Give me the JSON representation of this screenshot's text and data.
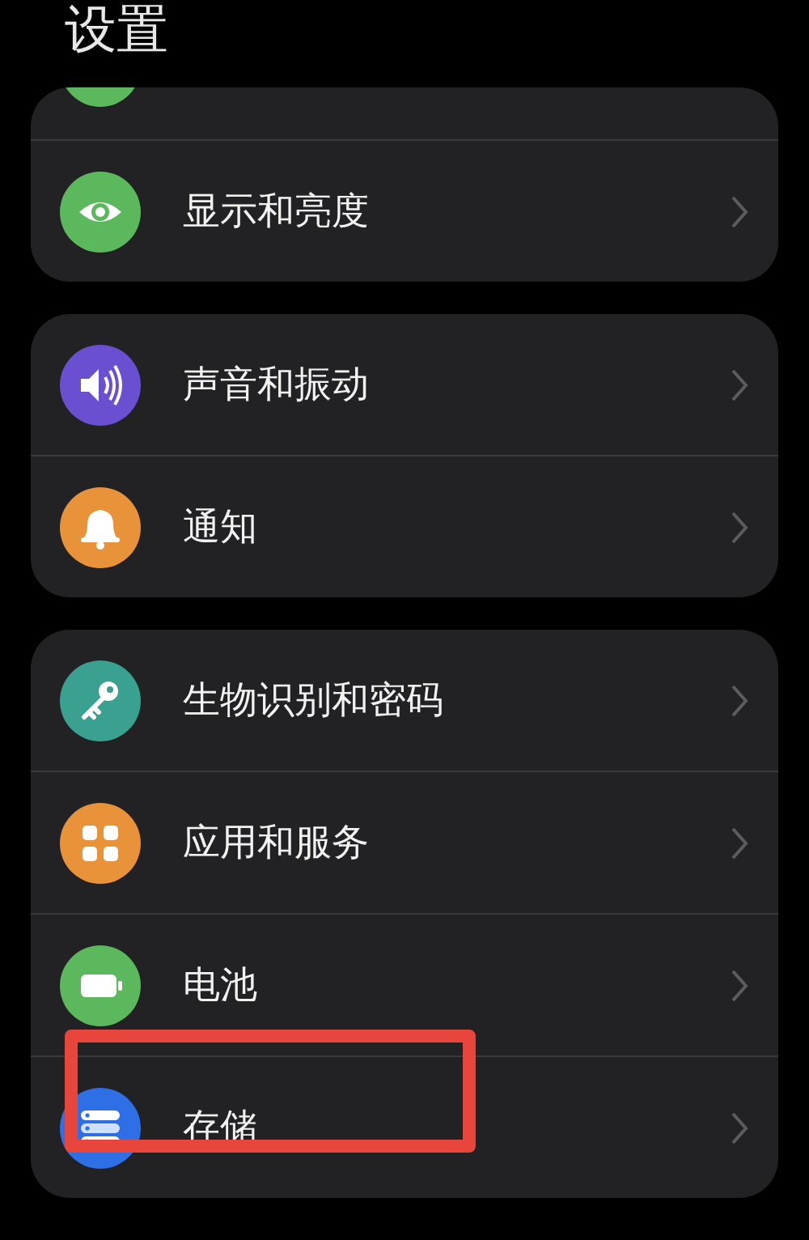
{
  "title": "设置",
  "sections": [
    {
      "items": [
        {
          "kind": "cut",
          "color": "#5cb85c",
          "highlighted": false
        },
        {
          "kind": "eye",
          "label": "显示和亮度",
          "color": "#5cb85c",
          "highlighted": false
        }
      ]
    },
    {
      "items": [
        {
          "kind": "speaker",
          "label": "声音和振动",
          "color": "#6a4fd0",
          "highlighted": false
        },
        {
          "kind": "bell",
          "label": "通知",
          "color": "#e8923a",
          "highlighted": false
        }
      ]
    },
    {
      "items": [
        {
          "kind": "key",
          "label": "生物识别和密码",
          "color": "#3aa08f",
          "highlighted": false
        },
        {
          "kind": "apps",
          "label": "应用和服务",
          "color": "#e8923a",
          "highlighted": false
        },
        {
          "kind": "battery",
          "label": "电池",
          "color": "#5cb85c",
          "highlighted": false
        },
        {
          "kind": "storage",
          "label": "存储",
          "color": "#2f6fe6",
          "highlighted": true
        }
      ]
    }
  ]
}
